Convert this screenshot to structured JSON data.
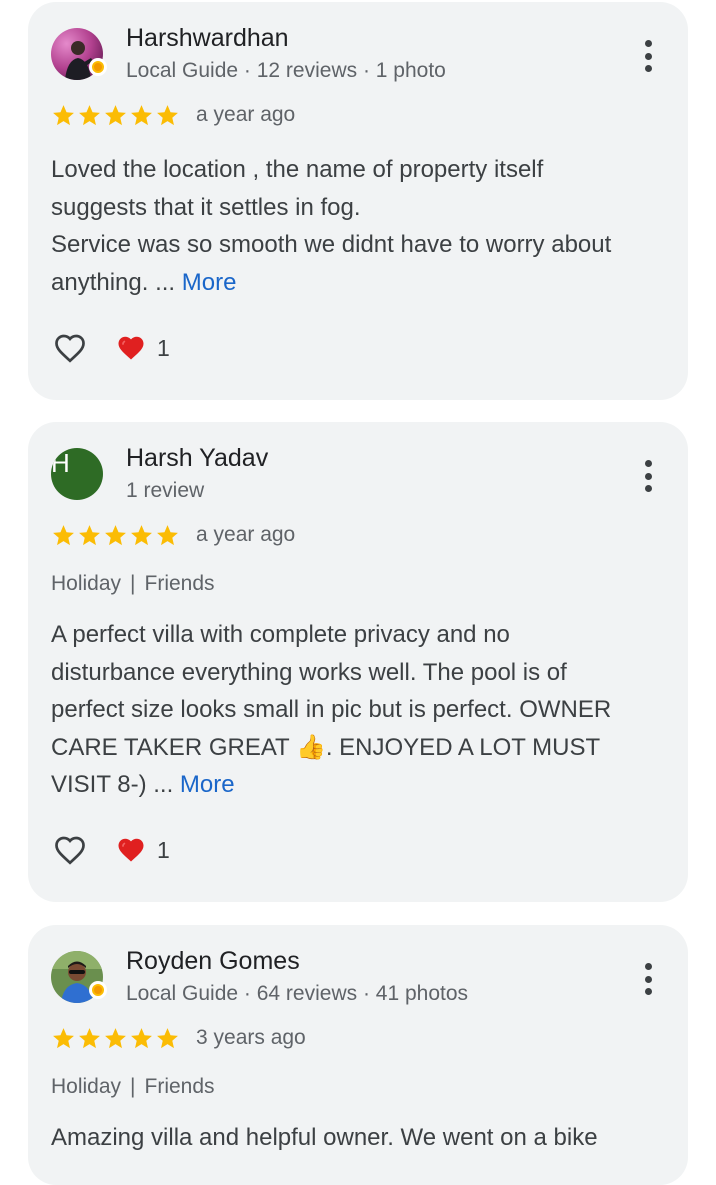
{
  "colors": {
    "card_bg": "#f1f3f4",
    "star": "#fbbc04",
    "link": "#1a66c9",
    "heart": "#e02020",
    "letter_avatar_bg": "#2e6b25"
  },
  "reviews": [
    {
      "name": "Harshwardhan",
      "meta": "Local Guide · 12 reviews · 1 photo",
      "rating": 5,
      "time": "a year ago",
      "text_lines": [
        "Loved the location , the name of property itself",
        "suggests that it settles in fog.",
        "Service was so smooth we didnt have to worry about",
        "anything. ... "
      ],
      "more_label": "More",
      "like_icon": "heart-outline-icon",
      "reaction_icon": "red-heart-icon",
      "reaction_count": "1"
    },
    {
      "name": "Harsh Yadav",
      "avatar_letter": "H",
      "meta": "1 review",
      "rating": 5,
      "time": "a year ago",
      "tags": [
        "Holiday",
        "|",
        "Friends"
      ],
      "text_lines": [
        "A perfect villa with complete privacy and no",
        "disturbance everything works well. The pool is of",
        "perfect size looks small in pic but is perfect. OWNER",
        "CARE TAKER GREAT 👍. ENJOYED A LOT MUST",
        "VISIT 8-) ... "
      ],
      "more_label": "More",
      "like_icon": "heart-outline-icon",
      "reaction_icon": "red-heart-icon",
      "reaction_count": "1"
    },
    {
      "name": "Royden Gomes",
      "meta": "Local Guide · 64 reviews · 41 photos",
      "rating": 5,
      "time": "3 years ago",
      "tags": [
        "Holiday",
        "|",
        "Friends"
      ],
      "text_lines": [
        "Amazing villa and helpful owner. We went on a bike"
      ]
    }
  ]
}
